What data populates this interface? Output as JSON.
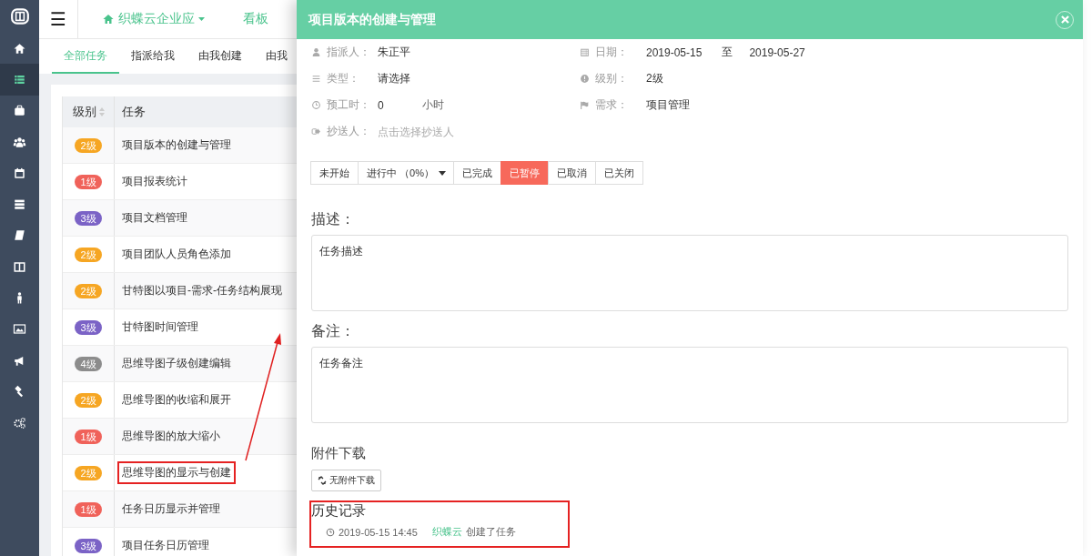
{
  "sidebar": {
    "items": [
      {
        "selected": false
      },
      {
        "selected": true
      },
      {
        "selected": false
      },
      {
        "selected": false
      },
      {
        "selected": false
      },
      {
        "selected": false
      },
      {
        "selected": false
      },
      {
        "selected": false
      },
      {
        "selected": false
      },
      {
        "selected": false
      },
      {
        "selected": false
      },
      {
        "selected": false
      },
      {
        "selected": false
      }
    ]
  },
  "header": {
    "menu_icon": "☰",
    "app_name": "织蝶云企业应",
    "board": "看板"
  },
  "tabs": [
    {
      "label": "全部任务",
      "selected": true
    },
    {
      "label": "指派给我",
      "selected": false
    },
    {
      "label": "由我创建",
      "selected": false
    },
    {
      "label": "由我",
      "selected": false
    }
  ],
  "table": {
    "columns": [
      "级别",
      "任务"
    ],
    "rows": [
      {
        "level": "2级",
        "color": "#f6a623",
        "task": "项目版本的创建与管理",
        "highlighted": false
      },
      {
        "level": "1级",
        "color": "#f0625a",
        "task": "项目报表统计",
        "highlighted": false
      },
      {
        "level": "3级",
        "color": "#7b63c6",
        "task": "项目文档管理",
        "highlighted": false
      },
      {
        "level": "2级",
        "color": "#f6a623",
        "task": "项目团队人员角色添加",
        "highlighted": false
      },
      {
        "level": "2级",
        "color": "#f6a623",
        "task": "甘特图以项目-需求-任务结构展现",
        "highlighted": false
      },
      {
        "level": "3级",
        "color": "#7b63c6",
        "task": "甘特图时间管理",
        "highlighted": false
      },
      {
        "level": "4级",
        "color": "#8c8c8c",
        "task": "思维导图子级创建编辑",
        "highlighted": false
      },
      {
        "level": "2级",
        "color": "#f6a623",
        "task": "思维导图的收缩和展开",
        "highlighted": false
      },
      {
        "level": "1级",
        "color": "#f0625a",
        "task": "思维导图的放大缩小",
        "highlighted": false
      },
      {
        "level": "2级",
        "color": "#f6a623",
        "task": "思维导图的显示与创建",
        "highlighted": true
      },
      {
        "level": "1级",
        "color": "#f0625a",
        "task": "任务日历显示并管理",
        "highlighted": false
      },
      {
        "level": "3级",
        "color": "#7b63c6",
        "task": "项目任务日历管理",
        "highlighted": false
      }
    ]
  },
  "drawer": {
    "title": "项目版本的创建与管理",
    "field_rows": [
      [
        {
          "kind": "text",
          "label": "指派人：",
          "value": "朱正平"
        },
        {
          "kind": "range",
          "label": "日期：",
          "value": "2019-05-15",
          "separator": "至",
          "value_end": "2019-05-27"
        }
      ],
      [
        {
          "kind": "text",
          "label": "类型：",
          "value": "请选择"
        },
        {
          "kind": "text",
          "label": "级别：",
          "value": "2级"
        }
      ],
      [
        {
          "kind": "hours",
          "label": "预工时：",
          "value": "0",
          "unit": "小时"
        },
        {
          "kind": "text",
          "label": "需求：",
          "value": "项目管理"
        }
      ],
      [
        {
          "kind": "picker",
          "label": "抄送人：",
          "placeholder": "点击选择抄送人"
        }
      ]
    ],
    "statuses": [
      {
        "kind": "button",
        "label": "未开始",
        "selected": false
      },
      {
        "kind": "dropdown",
        "label": "进行中 （0%）",
        "selected": false
      },
      {
        "kind": "button",
        "label": "已完成",
        "selected": false
      },
      {
        "kind": "button",
        "label": "已暂停",
        "selected": true
      },
      {
        "kind": "button",
        "label": "已取消",
        "selected": false
      },
      {
        "kind": "button",
        "label": "已关闭",
        "selected": false
      }
    ],
    "description": {
      "title": "描述：",
      "value": "任务描述"
    },
    "note": {
      "title": "备注：",
      "value": "任务备注"
    },
    "attachments": {
      "title": "附件下载",
      "button": "无附件下载"
    },
    "history": {
      "title": "历史记录",
      "highlighted": true,
      "entries": [
        {
          "time": "2019-05-15 14:45",
          "user": "织蝶云",
          "action": "创建了任务"
        }
      ]
    }
  }
}
